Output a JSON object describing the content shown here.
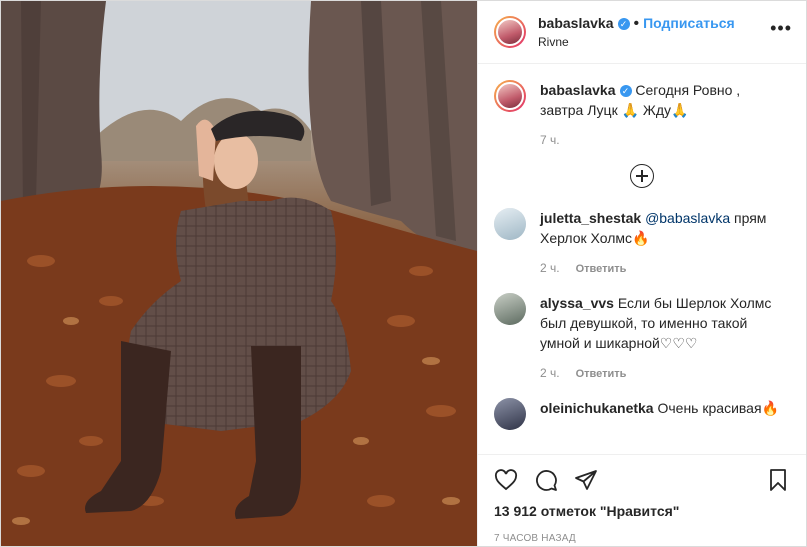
{
  "header": {
    "username": "babaslavka",
    "separator": "•",
    "follow_label": "Подписаться",
    "location": "Rivne",
    "more_label": "•••"
  },
  "caption": {
    "username": "babaslavka",
    "text": "Сегодня Ровно , завтра Луцк 🙏 Жду🙏",
    "time": "7 ч."
  },
  "comments": [
    {
      "username": "juletta_shestak",
      "mention": "@babaslavka",
      "text": "прям Херлок Холмс🔥",
      "time": "2 ч.",
      "reply_label": "Ответить"
    },
    {
      "username": "alyssa_vvs",
      "text": "Если бы Шерлок Холмс был девушкой, то именно такой умной и шикарной♡♡♡",
      "time": "2 ч.",
      "reply_label": "Ответить"
    },
    {
      "username": "oleinichukanetka",
      "text": "Очень красивая🔥"
    }
  ],
  "footer": {
    "likes": "13 912 отметок \"Нравится\"",
    "posted": "7 часов назад"
  },
  "icons": {
    "like": "heart-icon",
    "comment": "comment-icon",
    "share": "share-icon",
    "save": "bookmark-icon",
    "add": "plus-circle-icon"
  },
  "colors": {
    "accent": "#3897f0",
    "muted": "#8e8e8e",
    "text": "#262626"
  }
}
